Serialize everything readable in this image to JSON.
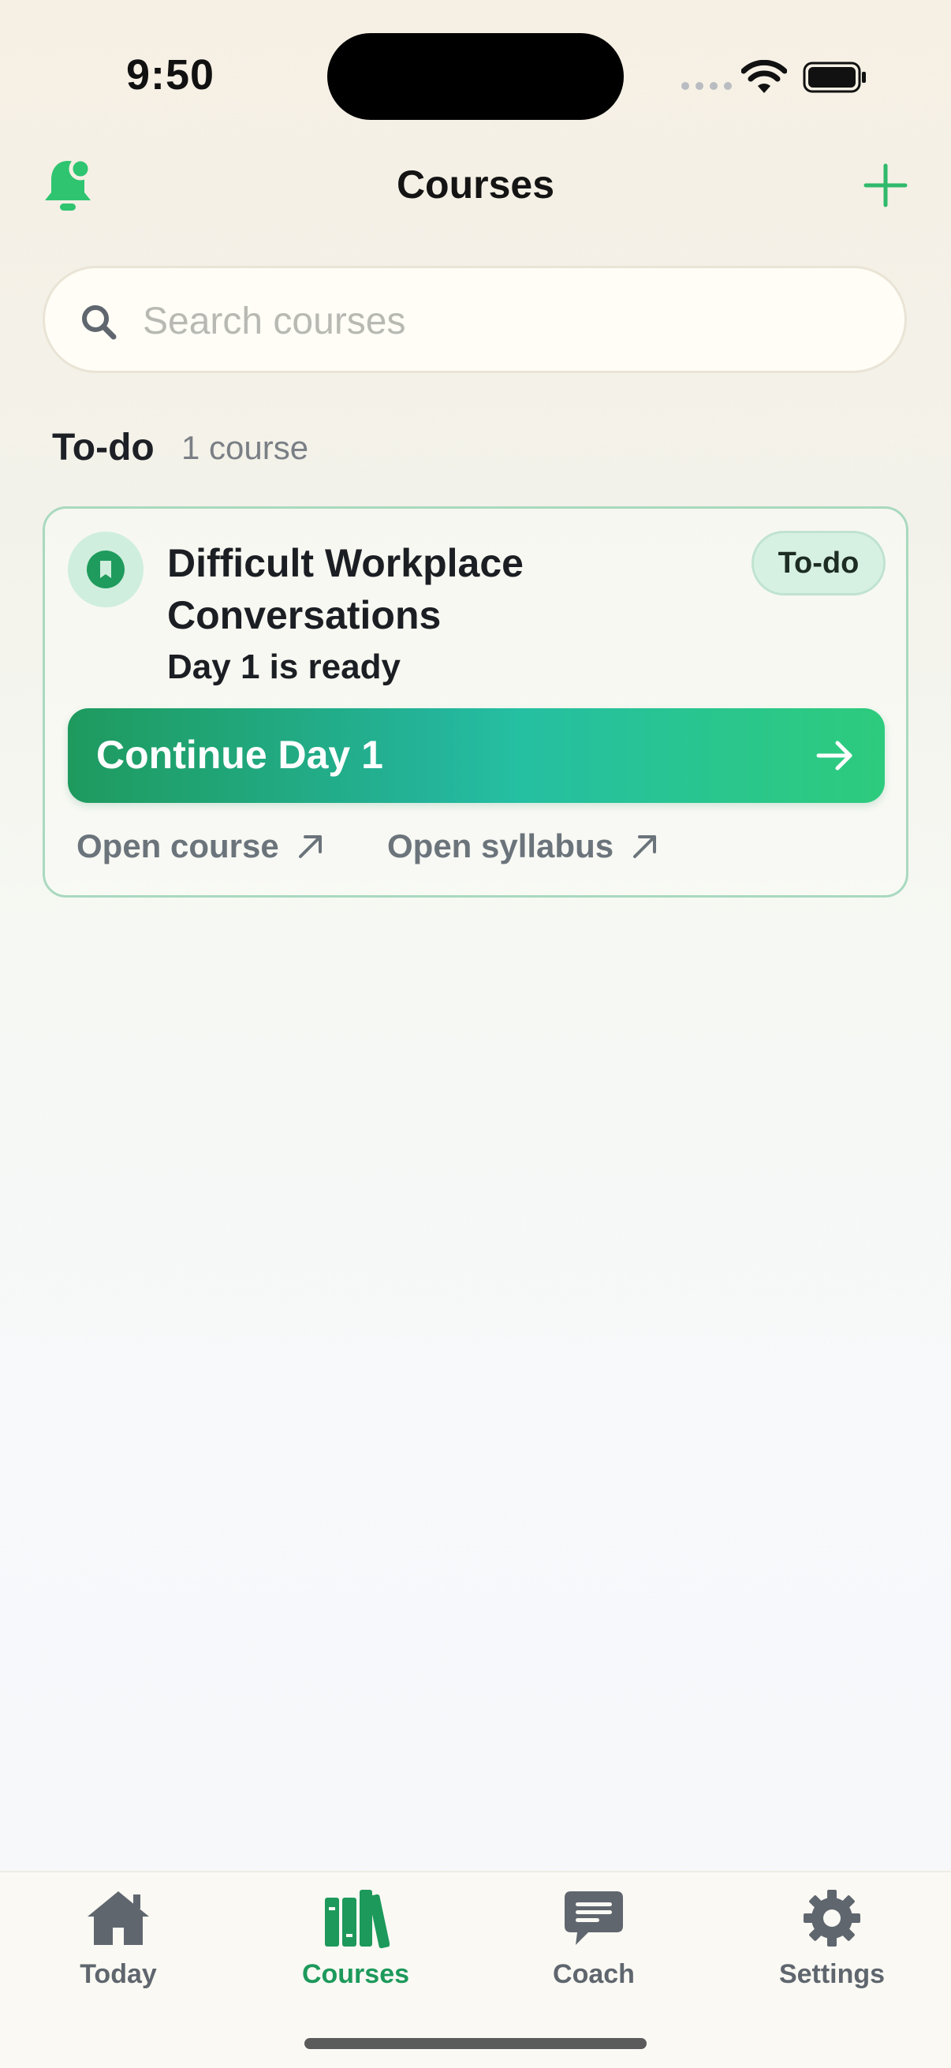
{
  "status_bar": {
    "time": "9:50"
  },
  "header": {
    "title": "Courses",
    "icons": {
      "left": "bell-icon",
      "right": "plus-icon"
    }
  },
  "search": {
    "placeholder": "Search courses",
    "value": ""
  },
  "section": {
    "title": "To-do",
    "count": "1 course"
  },
  "course_card": {
    "title": "Difficult Workplace Conversations",
    "subtitle": "Day 1 is ready",
    "badge": "To-do",
    "primary_action": "Continue Day 1",
    "links": {
      "open_course": "Open course",
      "open_syllabus": "Open syllabus"
    }
  },
  "tab_bar": {
    "items": [
      {
        "label": "Today",
        "icon": "house-icon",
        "active": false
      },
      {
        "label": "Courses",
        "icon": "books-icon",
        "active": true
      },
      {
        "label": "Coach",
        "icon": "chat-bubble-icon",
        "active": false
      },
      {
        "label": "Settings",
        "icon": "gear-icon",
        "active": false
      }
    ]
  },
  "colors": {
    "accent": "#1d9a5b",
    "accent_light": "#2ecb79",
    "badge_bg": "#d6f0e1",
    "card_border": "#a9d9bf",
    "muted_text": "#6c747b"
  }
}
